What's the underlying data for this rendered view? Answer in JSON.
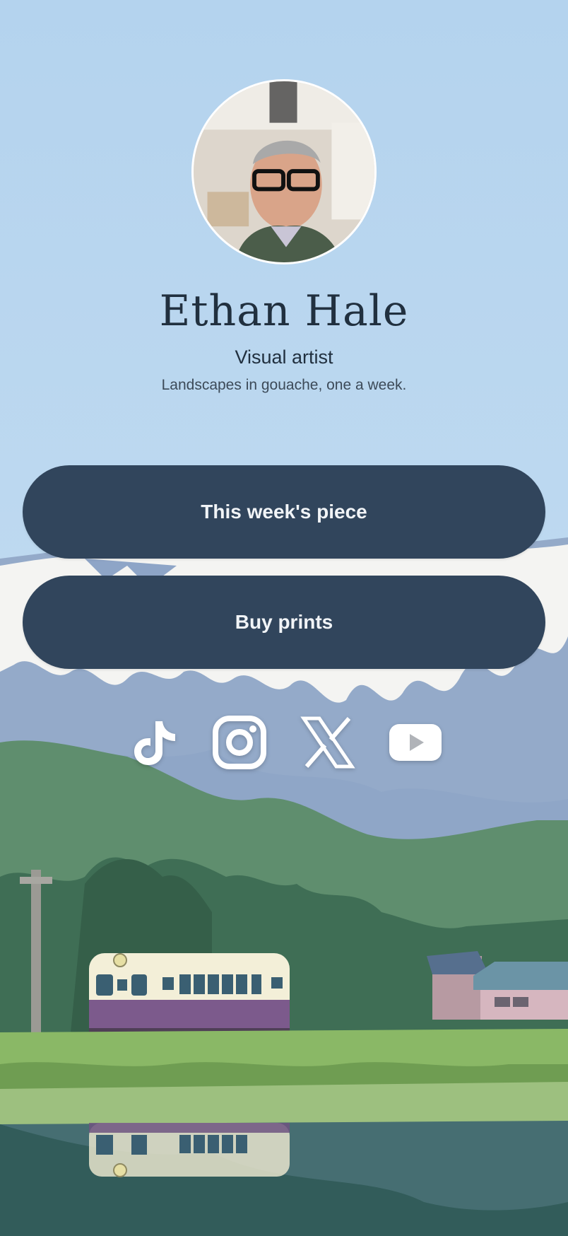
{
  "profile": {
    "name": "Ethan Hale",
    "title": "Visual artist",
    "bio": "Landscapes in gouache, one a week."
  },
  "links": [
    {
      "label": "This week's piece"
    },
    {
      "label": "Buy prints"
    }
  ],
  "socials": [
    {
      "icon": "tiktok-icon"
    },
    {
      "icon": "instagram-icon"
    },
    {
      "icon": "x-icon"
    },
    {
      "icon": "youtube-icon"
    }
  ],
  "colors": {
    "button_bg": "#31455c",
    "button_text": "#f1f4f7",
    "name_text": "#21303f",
    "sky": "#b9d6ee"
  }
}
